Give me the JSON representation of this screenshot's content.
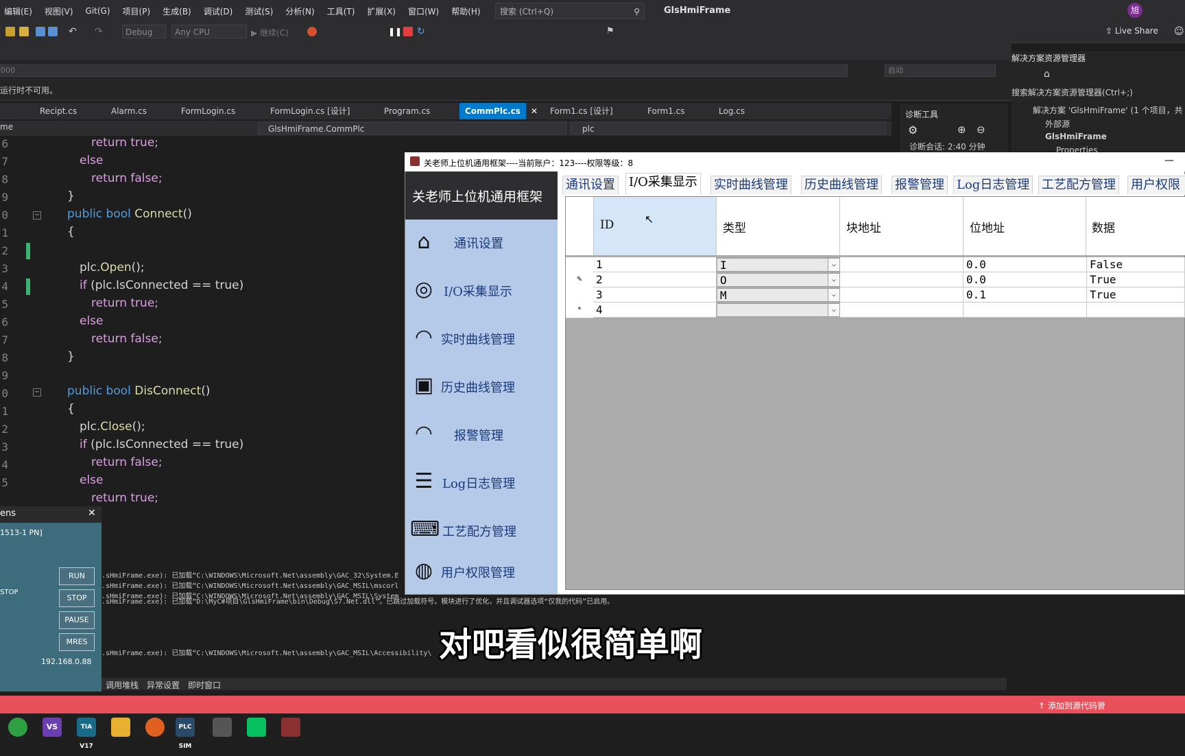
{
  "menu": [
    "编辑(E)",
    "视图(V)",
    "Git(G)",
    "项目(P)",
    "生成(B)",
    "调试(D)",
    "测试(S)",
    "分析(N)",
    "工具(T)",
    "扩展(X)",
    "窗口(W)",
    "帮助(H)"
  ],
  "search_label": "搜索 (Ctrl+Q)",
  "vs_title": "GlsHmiFrame",
  "user_initial": "旭",
  "toolbar": {
    "config": "Debug",
    "platform": "Any CPU",
    "continue": "继续(C)",
    "live_share": "Live Share"
  },
  "bar3": {
    "num": "000",
    "right": "启动"
  },
  "unavailable_text": "运行时不可用。",
  "tabs": [
    "Recipt.cs",
    "Alarm.cs",
    "FormLogin.cs",
    "FormLogin.cs [设计]",
    "Program.cs",
    "CommPlc.cs",
    "Form1.cs [设计]",
    "Form1.cs",
    "Log.cs"
  ],
  "nav": {
    "left": "me",
    "class": "GlsHmiFrame.CommPlc",
    "member": "plc"
  },
  "line_numbers": [
    "6",
    "7",
    "8",
    "9",
    "0",
    "1",
    "2",
    "3",
    "4",
    "5",
    "6",
    "7",
    "8",
    "9",
    "0",
    "1",
    "2",
    "3",
    "4",
    "5"
  ],
  "code": {
    "return_true": "return true;",
    "else": "else",
    "return_false": "return false;",
    "close_brace": "}",
    "open_brace": "{",
    "connect_sig_kw": "public bool ",
    "connect_fn": "Connect",
    "parens": "()",
    "plc_open_obj": "plc.",
    "plc_open_fn": "Open",
    "semi_call": "();",
    "if_kw": "if ",
    "if_cond_a": "(plc.",
    "is_connected": "IsConnected",
    "eq_true": " == true)",
    "disconnect_fn": "DisConnect",
    "plc_close_fn": "Close"
  },
  "diag": {
    "title": "诊断工具",
    "session": "诊断会话: 2:40 分钟"
  },
  "solution": {
    "title": "解决方案资源管理器",
    "search": "搜索解决方案资源管理器(Ctrl+;)",
    "items": [
      "解决方案 'GlsHmiFrame' (1 个项目，共 1",
      "外部源",
      "GlsHmiFrame",
      "Properties"
    ]
  },
  "output_lines": [
    ".sHmiFrame.exe): 已加载“C:\\WINDOWS\\Microsoft.Net\\assembly\\GAC_32\\System.E",
    ".sHmiFrame.exe): 已加载“C:\\WINDOWS\\Microsoft.Net\\assembly\\GAC_MSIL\\mscorl",
    ".sHmiFrame.exe): 已加载“C:\\WINDOWS\\Microsoft.Net\\assembly\\GAC_MSIL\\System",
    ".sHmiFrame.exe): 已加载“D:\\MyC#项目\\GlsHmiFrame\\bin\\Debug\\S7.Net.dll”。已跳过加载符号。模块进行了优化，并且调试器选项“仅我的代码”已启用。",
    ".sHmiFrame.exe): 已加载“C:\\WINDOWS\\Microsoft.Net\\assembly\\GAC_MSIL\\Accessibility\\"
  ],
  "bottom_tabs": [
    "调用堆栈",
    "异常设置",
    "即时窗口"
  ],
  "plcsim": {
    "title": "ens",
    "device": "1513-1 PN]",
    "stop_label": "STOP",
    "buttons": [
      "RUN",
      "STOP",
      "PAUSE",
      "MRES"
    ],
    "ip": "192.168.0.88"
  },
  "status": {
    "add_source": "添加到源代码管"
  },
  "taskbar": [
    "VS",
    "TIA V17",
    "PLC SIM"
  ],
  "app": {
    "title": "关老师上位机通用框架----当前账户：123----权限等级：8",
    "name": "关老师上位机通用框架",
    "nav": [
      "通讯设置",
      "I/O采集显示",
      "实时曲线管理",
      "历史曲线管理",
      "报警管理",
      "Log日志管理",
      "工艺配方管理",
      "用户权限管理"
    ],
    "tabs": [
      "通讯设置",
      "I/O采集显示",
      "实时曲线管理",
      "历史曲线管理",
      "报警管理",
      "Log日志管理",
      "工艺配方管理",
      "用户权限"
    ],
    "selected_tab": 1,
    "grid": {
      "headers": [
        "ID",
        "类型",
        "块地址",
        "位地址",
        "数据"
      ],
      "rows": [
        {
          "marker": "",
          "id": "1",
          "type": "I",
          "block": "",
          "bit": "0.0",
          "data": "False"
        },
        {
          "marker": "✎",
          "id": "2",
          "type": "O",
          "block": "",
          "bit": "0.0",
          "data": "True"
        },
        {
          "marker": "",
          "id": "3",
          "type": "M",
          "block": "",
          "bit": "0.1",
          "data": "True"
        },
        {
          "marker": "*",
          "id": "4",
          "type": "",
          "block": "",
          "bit": "",
          "data": ""
        }
      ]
    }
  },
  "subtitle": "对吧看似很简单啊"
}
